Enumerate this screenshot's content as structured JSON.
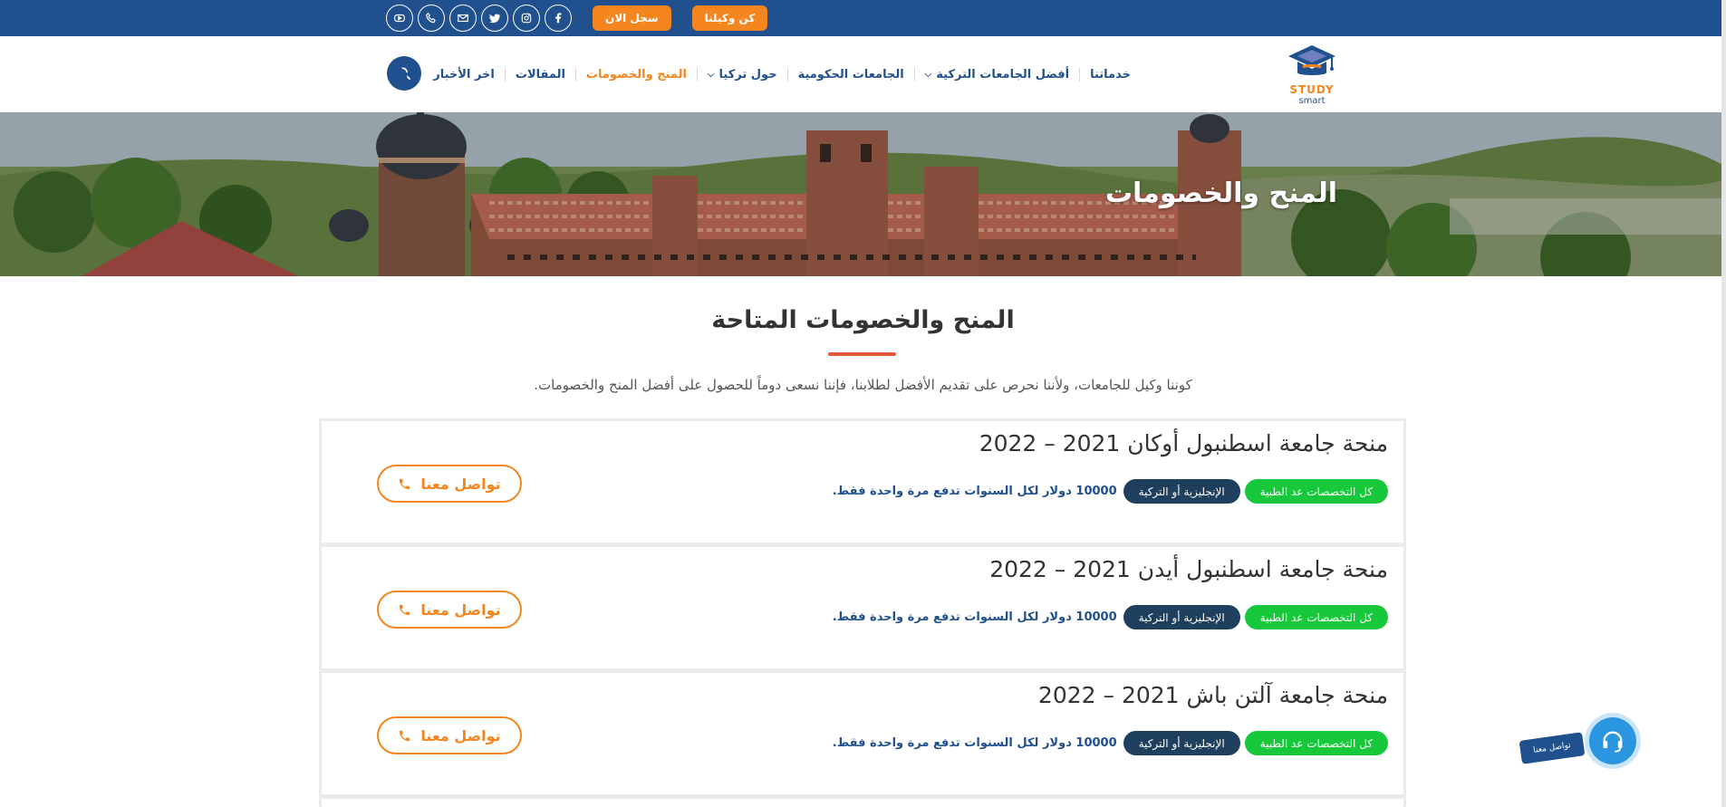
{
  "topbar": {
    "social_icons": [
      "youtube-icon",
      "phone-icon",
      "mail-icon",
      "twitter-icon",
      "instagram-icon",
      "facebook-icon"
    ],
    "register_label": "سجل الان",
    "agent_label": "كن وكيلنا"
  },
  "header": {
    "logo_text_main": "STUDY",
    "logo_text_sub": "smart",
    "nav": [
      {
        "label": "خدماتنا",
        "has_dropdown": false,
        "active": false
      },
      {
        "label": "أفضل الجامعات التركية",
        "has_dropdown": true,
        "active": false
      },
      {
        "label": "الجامعات الحكومية",
        "has_dropdown": false,
        "active": false
      },
      {
        "label": "حول تركيا",
        "has_dropdown": true,
        "active": false
      },
      {
        "label": "المنح والخصومات",
        "has_dropdown": false,
        "active": true
      },
      {
        "label": "المقالات",
        "has_dropdown": false,
        "active": false
      },
      {
        "label": "اخر الأخبار",
        "has_dropdown": false,
        "active": false
      }
    ]
  },
  "hero": {
    "title": "المنح والخصومات"
  },
  "section": {
    "title": "المنح والخصومات المتاحة",
    "description": "كوننا وكيل للجامعات، ولأننا نحرص على تقديم الأفضل لطلابنا، فإننا نسعى دوماً للحصول على أفضل المنح والخصومات."
  },
  "cards": [
    {
      "title": "منحة جامعة اسطنبول أوكان 2021 – 2022",
      "tag_specialties": "كل التخصصات عد الطبية",
      "tag_language": "الإنجليزية أو التركية",
      "price": "10000 دولار لكل السنوات تدفع مرة واحدة فقط.",
      "button_label": "تواصل معنا"
    },
    {
      "title": "منحة جامعة اسطنبول أيدن 2021 – 2022",
      "tag_specialties": "كل التخصصات عد الطبية",
      "tag_language": "الإنجليزية أو التركية",
      "price": "10000 دولار لكل السنوات تدفع مرة واحدة فقط.",
      "button_label": "تواصل معنا"
    },
    {
      "title": "منحة جامعة آلتن باش 2021 – 2022",
      "tag_specialties": "كل التخصصات عد الطبية",
      "tag_language": "الإنجليزية أو التركية",
      "price": "10000 دولار لكل السنوات تدفع مرة واحدة فقط.",
      "button_label": "تواصل معنا"
    }
  ],
  "floating_contact": {
    "label": "تواصل معنا"
  },
  "colors": {
    "primary_navy": "#21508f",
    "accent_orange": "#f5851f",
    "tag_green": "#17c93a",
    "tag_dark": "#1f3f5f"
  }
}
